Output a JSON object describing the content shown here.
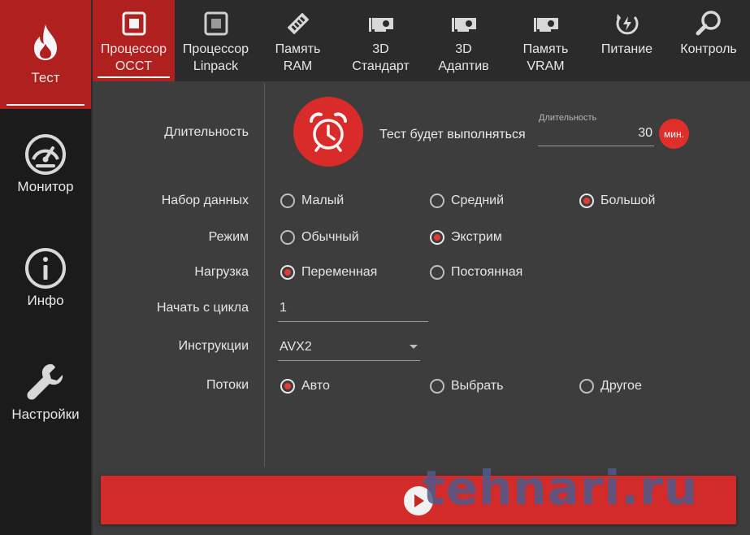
{
  "sidebar": {
    "items": [
      {
        "label": "Тест",
        "icon": "flame-icon"
      },
      {
        "label": "Монитор",
        "icon": "gauge-icon"
      },
      {
        "label": "Инфо",
        "icon": "info-icon"
      },
      {
        "label": "Настройки",
        "icon": "wrench-icon"
      }
    ]
  },
  "tabs": [
    {
      "label": "Процессор\nOCCT",
      "icon": "cpu-icon"
    },
    {
      "label": "Процессор\nLinpack",
      "icon": "cpu-icon"
    },
    {
      "label": "Память\nRAM",
      "icon": "ram-icon"
    },
    {
      "label": "3D\nСтандарт",
      "icon": "gpu-icon"
    },
    {
      "label": "3D\nАдаптив",
      "icon": "gpu-icon"
    },
    {
      "label": "Память\nVRAM",
      "icon": "gpu-icon"
    },
    {
      "label": "Питание",
      "icon": "power-icon"
    },
    {
      "label": "Контроль",
      "icon": "search-icon"
    }
  ],
  "form": {
    "duration": {
      "label": "Длительность",
      "text": "Тест будет выполняться",
      "field_label": "Длительность",
      "value": "30",
      "unit": "мин."
    },
    "dataset": {
      "label": "Набор данных",
      "options": [
        "Малый",
        "Средний",
        "Большой"
      ],
      "selected": "Большой"
    },
    "mode": {
      "label": "Режим",
      "options": [
        "Обычный",
        "Экстрим"
      ],
      "selected": "Экстрим"
    },
    "load": {
      "label": "Нагрузка",
      "options": [
        "Переменная",
        "Постоянная"
      ],
      "selected": "Переменная"
    },
    "start_cycle": {
      "label": "Начать с цикла",
      "value": "1"
    },
    "instructions": {
      "label": "Инструкции",
      "value": "AVX2"
    },
    "threads": {
      "label": "Потоки",
      "options": [
        "Авто",
        "Выбрать",
        "Другое"
      ],
      "selected": "Авто"
    }
  },
  "watermark": "tehnari.ru",
  "colors": {
    "accent": "#b0201f",
    "button": "#d32b29",
    "panel": "#3d3d3d",
    "topbar": "#2b2b2b",
    "sidebar": "#1b1b1b",
    "radio_dot": "#e23b35"
  }
}
